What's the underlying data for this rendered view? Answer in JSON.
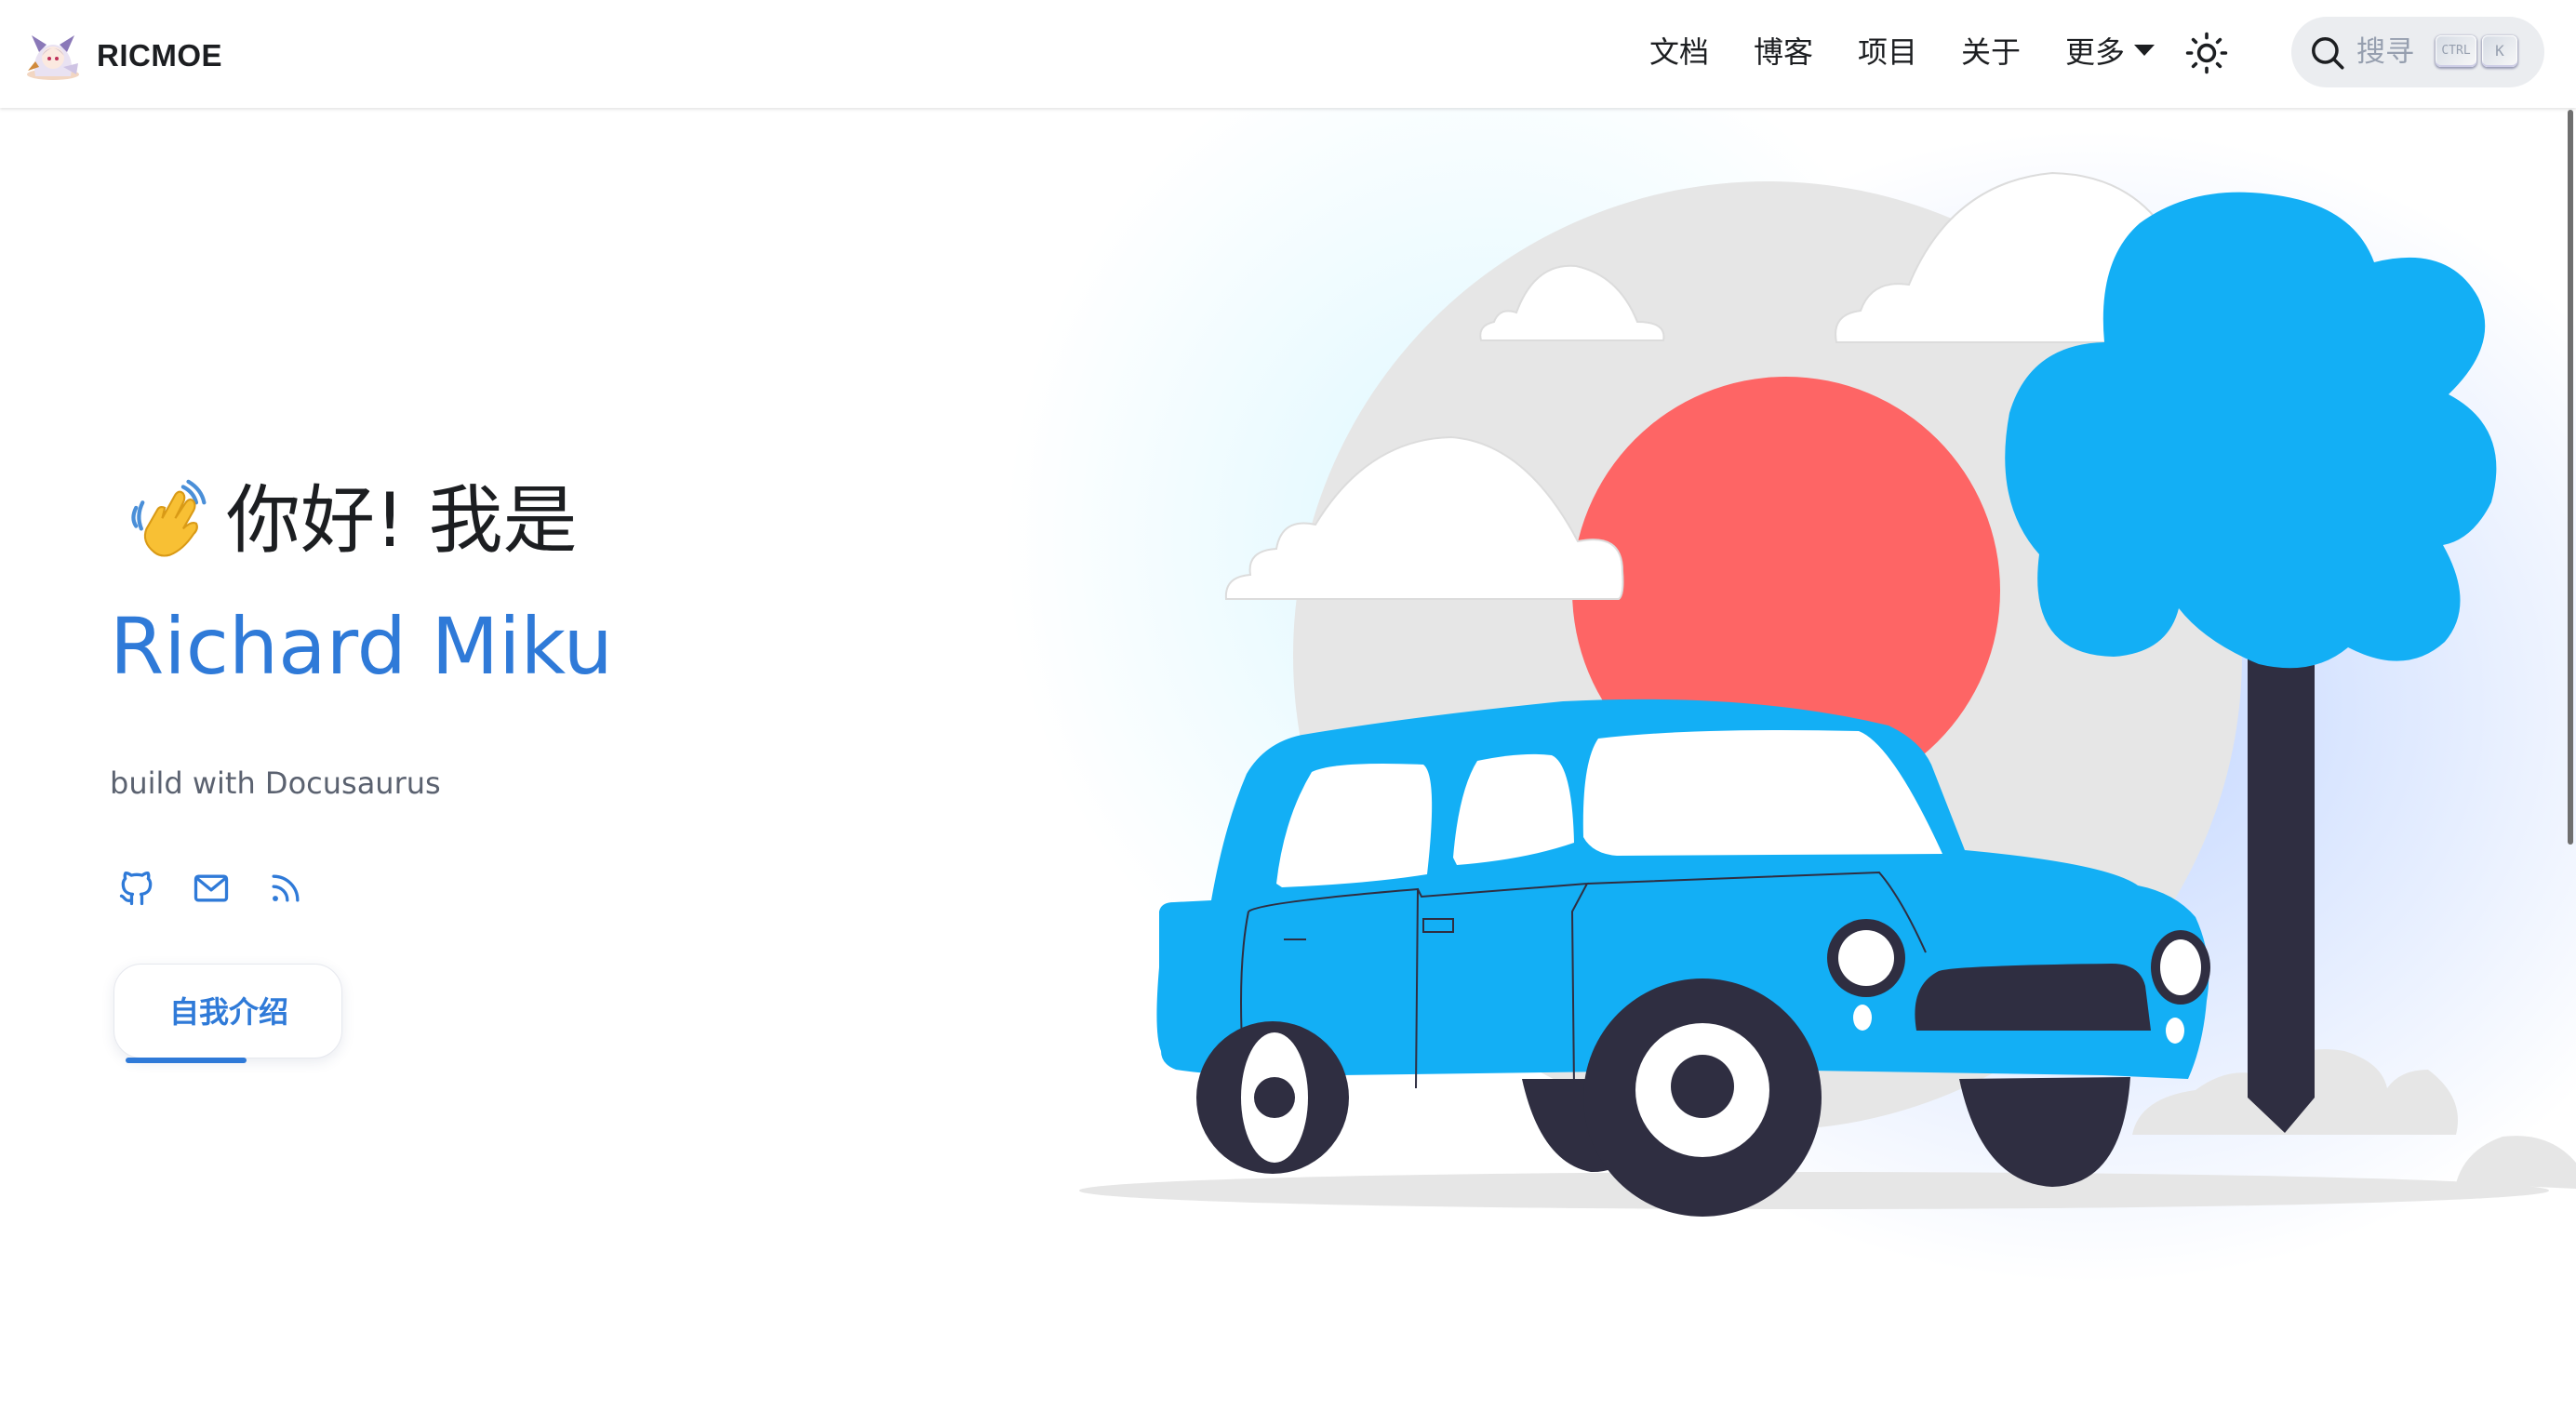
{
  "navbar": {
    "brand": {
      "title": "RICMOE"
    },
    "items": [
      {
        "label": "文档"
      },
      {
        "label": "博客"
      },
      {
        "label": "项目"
      },
      {
        "label": "关于"
      },
      {
        "label": "更多"
      }
    ],
    "theme_toggle_icon": "sun-icon",
    "search": {
      "placeholder": "搜寻",
      "shortcut_keys": [
        "CTRL",
        "K"
      ]
    }
  },
  "hero": {
    "greeting_emoji": "waving-hand-icon",
    "greeting": "你好! 我是",
    "name": "Richard Miku",
    "subtitle": "build with Docusaurus",
    "social_icons": [
      "github-icon",
      "mail-icon",
      "rss-icon"
    ],
    "intro_button": {
      "label": "自我介绍"
    }
  },
  "colors": {
    "accent": "#2f7ad8",
    "car": "#13aff5",
    "tree": "#13aff5",
    "sun": "#fe6565",
    "dark": "#2f2e41",
    "backdrop_circle": "#e6e6e6"
  }
}
